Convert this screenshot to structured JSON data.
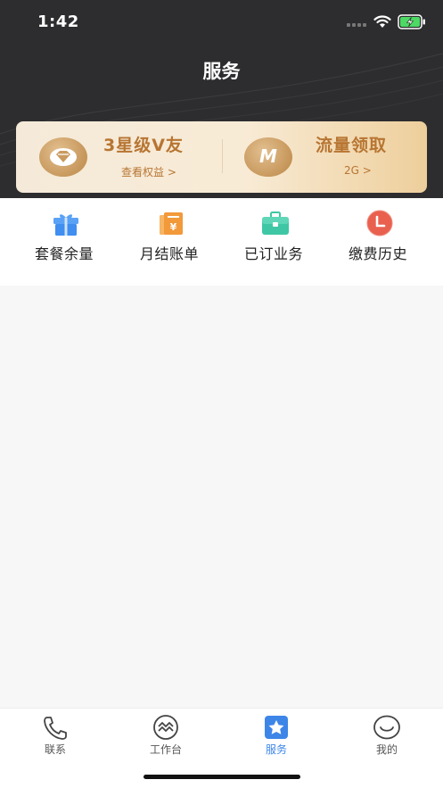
{
  "status_bar": {
    "time": "1:42"
  },
  "header": {
    "title": "服务"
  },
  "benefits_card": {
    "left": {
      "title": "3星级V友",
      "link": "查看权益 >"
    },
    "right": {
      "badge_letter": "M",
      "title": "流量领取",
      "link": "2G >"
    }
  },
  "quick_actions": [
    {
      "label": "套餐余量",
      "icon": "gift-icon",
      "color": "#3f8ef0"
    },
    {
      "label": "月结账单",
      "icon": "bill-icon",
      "color": "#f2993a"
    },
    {
      "label": "已订业务",
      "icon": "briefcase-icon",
      "color": "#3fc7a5"
    },
    {
      "label": "缴费历史",
      "icon": "clock-icon",
      "color": "#e9604f"
    }
  ],
  "tabbar": {
    "active_color": "#3d86e8",
    "items": [
      {
        "label": "联系",
        "icon": "phone-icon"
      },
      {
        "label": "工作台",
        "icon": "workbench-icon"
      },
      {
        "label": "服务",
        "icon": "star-icon"
      },
      {
        "label": "我的",
        "icon": "smile-icon"
      }
    ]
  }
}
